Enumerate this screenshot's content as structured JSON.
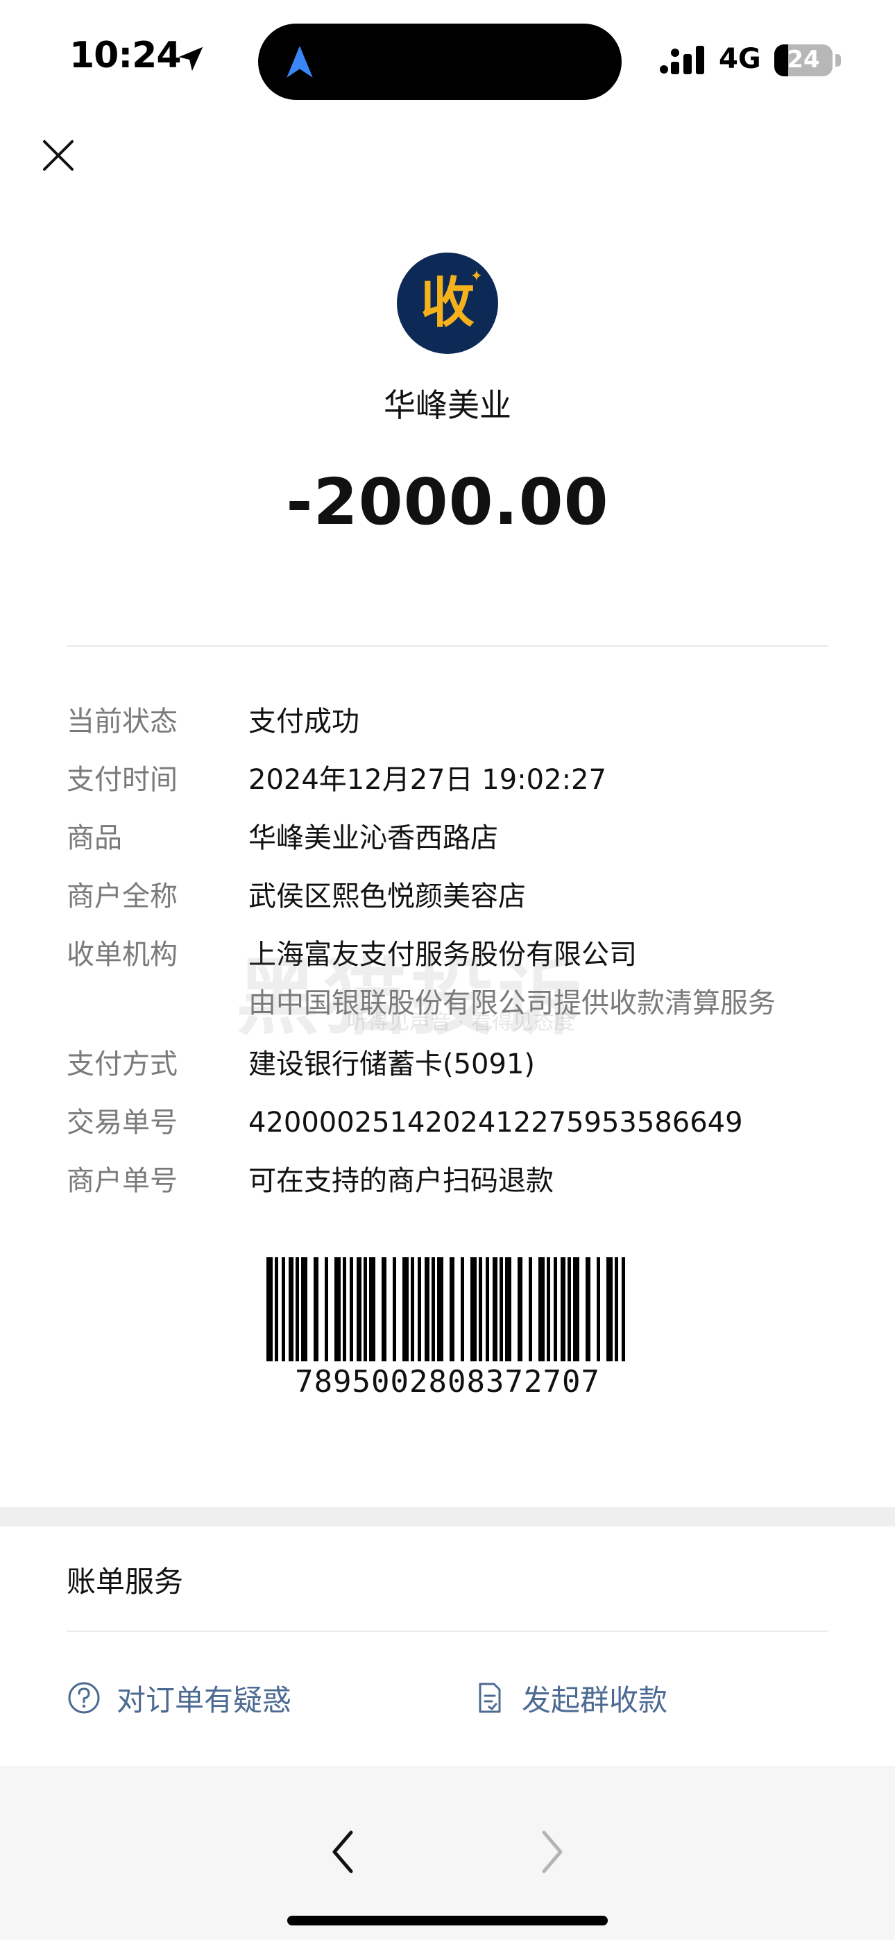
{
  "status_bar": {
    "time": "10:24",
    "network": "4G",
    "battery": "24",
    "battery_level": 0.24
  },
  "header": {
    "close_icon": "close-icon",
    "merchant_logo_char": "收",
    "merchant_name": "华峰美业",
    "amount": "-2000.00"
  },
  "details": {
    "status": {
      "label": "当前状态",
      "value": "支付成功"
    },
    "pay_time": {
      "label": "支付时间",
      "value": "2024年12月27日 19:02:27"
    },
    "product": {
      "label": "商品",
      "value": "华峰美业沁香西路店"
    },
    "merchant_full": {
      "label": "商户全称",
      "value": "武侯区熙色悦颜美容店"
    },
    "acquirer": {
      "label": "收单机构",
      "value": "上海富友支付服务股份有限公司",
      "sub": "由中国银联股份有限公司提供收款清算服务"
    },
    "pay_method": {
      "label": "支付方式",
      "value": "建设银行储蓄卡(5091)"
    },
    "txn_no": {
      "label": "交易单号",
      "value": "4200002514202412275953586649"
    },
    "merchant_no": {
      "label": "商户单号",
      "value": "可在支持的商户扫码退款"
    }
  },
  "watermark": {
    "text": "黑猫投诉",
    "sub": "听得见声音 · 看得见态度"
  },
  "barcode": {
    "number": "7895002808372707"
  },
  "bill_services": {
    "title": "账单服务",
    "items": [
      {
        "label": "对订单有疑惑",
        "icon": "question-circle-icon"
      },
      {
        "label": "发起群收款",
        "icon": "document-icon"
      }
    ]
  },
  "toolbar": {
    "back_icon": "chevron-left-icon",
    "forward_icon": "chevron-right-icon"
  },
  "colors": {
    "link": "#4c6a92",
    "label_gray": "#7a7a7a",
    "logo_bg": "#0d2a56",
    "logo_fg": "#f5b21a"
  }
}
